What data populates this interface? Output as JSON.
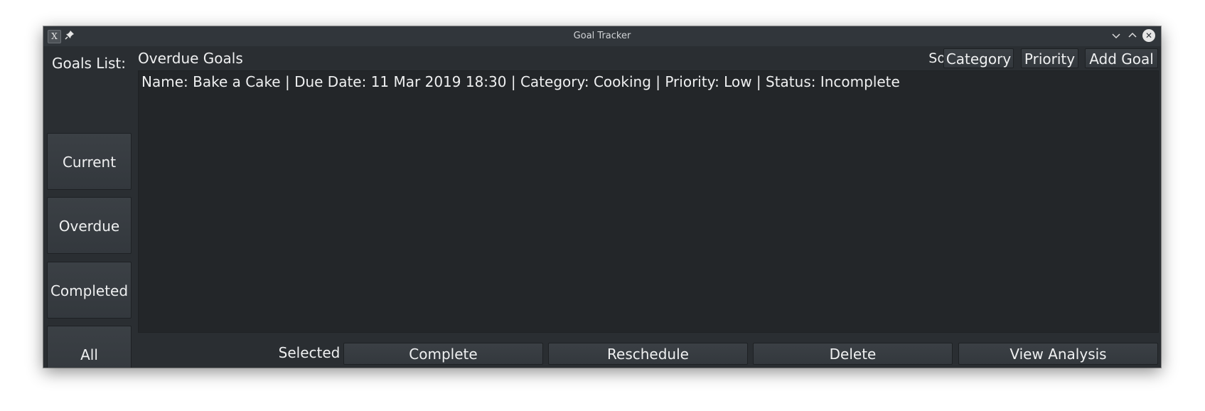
{
  "window": {
    "title": "Goal Tracker",
    "app_icon_glyph": "X",
    "pin_icon": "pin-icon",
    "minimize_icon": "chevron-down-icon",
    "maximize_icon": "chevron-up-icon",
    "close_icon": "close-icon"
  },
  "sidebar": {
    "label": "Goals List:",
    "items": [
      {
        "label": "Current"
      },
      {
        "label": "Overdue"
      },
      {
        "label": "Completed"
      },
      {
        "label": "All"
      }
    ]
  },
  "header": {
    "title": "Overdue Goals",
    "sorting_label": "Sorting:",
    "category_button": "Category",
    "priority_button": "Priority",
    "add_goal_button": "Add Goal"
  },
  "goals": [
    {
      "text": "Name: Bake a Cake | Due Date: 11 Mar 2019 18:30 | Category: Cooking | Priority: Low | Status: Incomplete"
    }
  ],
  "actions": {
    "selected_label": "Selected Goal:",
    "complete": "Complete",
    "reschedule": "Reschedule",
    "delete": "Delete",
    "view_analysis": "View Analysis"
  },
  "colors": {
    "window_bg": "#2a2e32",
    "list_bg": "#232629",
    "text": "#eff0f1"
  }
}
